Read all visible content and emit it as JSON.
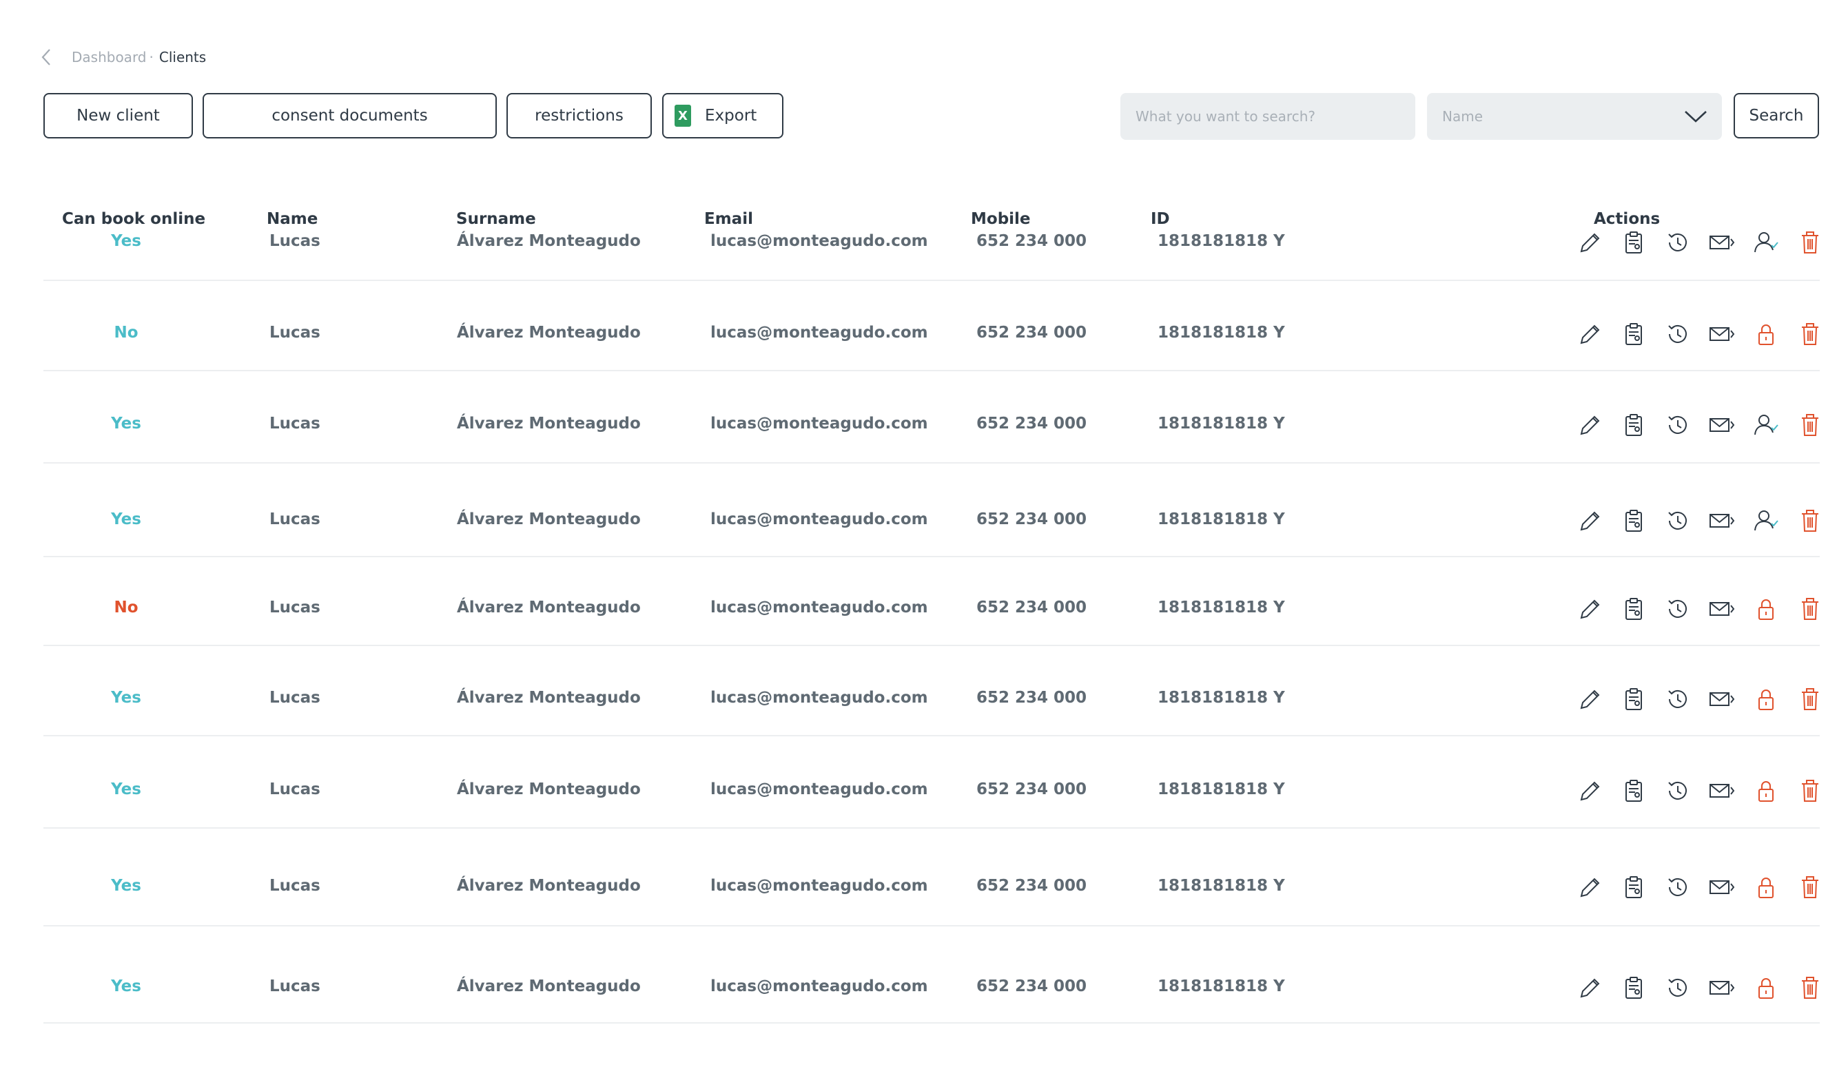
{
  "breadcrumb": {
    "parent": "Dashboard",
    "separator": "·",
    "current": "Clients"
  },
  "toolbar": {
    "new_client": "New client",
    "consent_documents": "consent documents",
    "restrictions": "restrictions",
    "export": "Export",
    "export_icon_letter": "X",
    "search_placeholder": "What you want to search?",
    "search_field_selected": "Name",
    "search_button": "Search"
  },
  "table": {
    "columns": [
      "Can book online",
      "Name",
      "Surname",
      "Email",
      "Mobile",
      "ID",
      "Actions"
    ],
    "rows": [
      {
        "book": "Yes",
        "book_state": "yes",
        "name": "Lucas",
        "surname": "Álvarez Monteagudo",
        "email": "lucas@monteagudo.com",
        "mobile": "652 234 000",
        "id": "1818181818 Y",
        "access": "user"
      },
      {
        "book": "No",
        "book_state": "no",
        "name": "Lucas",
        "surname": "Álvarez Monteagudo",
        "email": "lucas@monteagudo.com",
        "mobile": "652 234 000",
        "id": "1818181818 Y",
        "access": "lock"
      },
      {
        "book": "Yes",
        "book_state": "yes",
        "name": "Lucas",
        "surname": "Álvarez Monteagudo",
        "email": "lucas@monteagudo.com",
        "mobile": "652 234 000",
        "id": "1818181818 Y",
        "access": "user"
      },
      {
        "book": "Yes",
        "book_state": "yes",
        "name": "Lucas",
        "surname": "Álvarez Monteagudo",
        "email": "lucas@monteagudo.com",
        "mobile": "652 234 000",
        "id": "1818181818 Y",
        "access": "user"
      },
      {
        "book": "No",
        "book_state": "no-red",
        "name": "Lucas",
        "surname": "Álvarez Monteagudo",
        "email": "lucas@monteagudo.com",
        "mobile": "652 234 000",
        "id": "1818181818 Y",
        "access": "lock"
      },
      {
        "book": "Yes",
        "book_state": "yes",
        "name": "Lucas",
        "surname": "Álvarez Monteagudo",
        "email": "lucas@monteagudo.com",
        "mobile": "652 234 000",
        "id": "1818181818 Y",
        "access": "lock"
      },
      {
        "book": "Yes",
        "book_state": "yes",
        "name": "Lucas",
        "surname": "Álvarez Monteagudo",
        "email": "lucas@monteagudo.com",
        "mobile": "652 234 000",
        "id": "1818181818 Y",
        "access": "lock"
      },
      {
        "book": "Yes",
        "book_state": "yes",
        "name": "Lucas",
        "surname": "Álvarez Monteagudo",
        "email": "lucas@monteagudo.com",
        "mobile": "652 234 000",
        "id": "1818181818 Y",
        "access": "lock"
      },
      {
        "book": "Yes",
        "book_state": "yes",
        "name": "Lucas",
        "surname": "Álvarez Monteagudo",
        "email": "lucas@monteagudo.com",
        "mobile": "652 234 000",
        "id": "1818181818 Y",
        "access": "lock"
      }
    ]
  },
  "icons": [
    "edit-icon",
    "clipboard-icon",
    "history-icon",
    "send-email-icon",
    "user-check-icon",
    "lock-icon",
    "trash-icon"
  ],
  "colors": {
    "text": "#2f3a45",
    "muted": "#5f6a73",
    "yes": "#4bbcc8",
    "no_red": "#e0522d",
    "danger": "#e0522d",
    "excel": "#2e9b5f"
  }
}
